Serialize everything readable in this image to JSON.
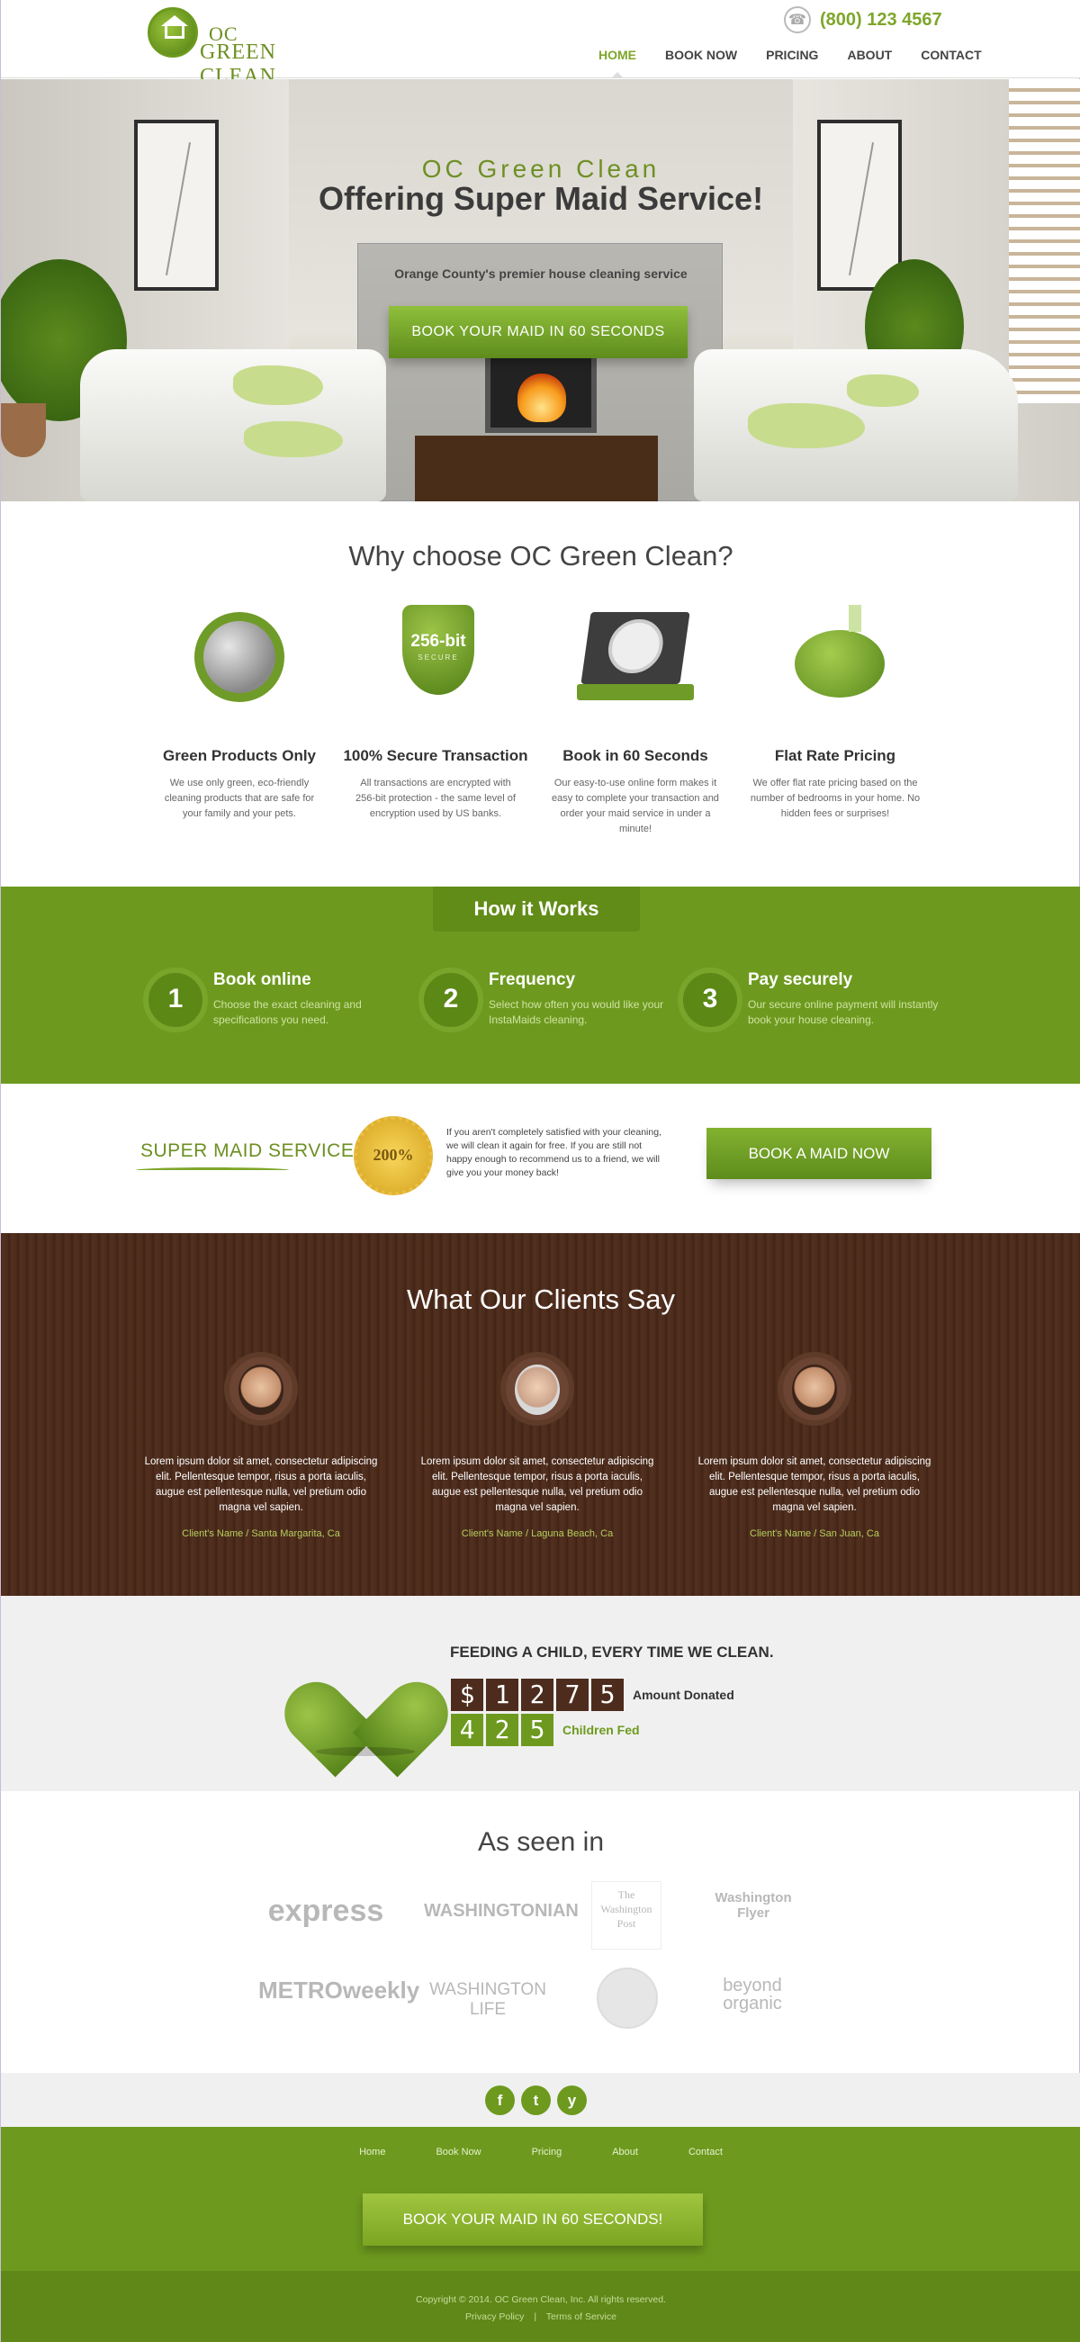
{
  "header": {
    "logo_line1": "OC",
    "logo_line2": "GREEN CLEAN",
    "phone": "(800) 123 4567",
    "nav": [
      "HOME",
      "BOOK NOW",
      "PRICING",
      "ABOUT",
      "CONTACT"
    ],
    "active_nav": "HOME"
  },
  "hero": {
    "brand": "OC Green Clean",
    "title": "Offering Super Maid Service!",
    "tagline": "Orange County's premier house cleaning service",
    "cta": "BOOK YOUR MAID IN 60 SECONDS"
  },
  "why": {
    "title": "Why choose OC Green Clean?",
    "features": [
      {
        "icon": "recycle-globe-icon",
        "title": "Green Products Only",
        "text": "We use only green, eco-friendly cleaning products that are safe for your family and your pets."
      },
      {
        "icon": "shield-256-bit-icon",
        "title": "100% Secure Transaction",
        "text": "All  transactions are encrypted with 256-bit protection - the same level of encryption used by US banks.",
        "badge_big": "256-bit",
        "badge_small": "SECURE"
      },
      {
        "icon": "laptop-clock-icon",
        "title": "Book in 60 Seconds",
        "text": "Our easy-to-use online form makes it easy to complete your transaction and order your maid service in under a minute!"
      },
      {
        "icon": "piggy-bank-icon",
        "title": "Flat Rate Pricing",
        "text": "We offer flat rate pricing based on the number of bedrooms in your home. No hidden fees or surprises!"
      }
    ]
  },
  "how": {
    "title": "How it Works",
    "steps": [
      {
        "num": "1",
        "title": "Book online",
        "text": "Choose the exact cleaning and specifications you need."
      },
      {
        "num": "2",
        "title": "Frequency",
        "text": "Select how often you would like your InstaMaids cleaning."
      },
      {
        "num": "3",
        "title": "Pay securely",
        "text": "Our secure online payment will instantly book your house cleaning."
      }
    ]
  },
  "guarantee": {
    "label": "SUPER MAID SERVICE",
    "seal": "200%",
    "text": "If you aren't completely satisfied with your cleaning, we will clean it again for free. If you are still not happy enough to recommend us to a friend, we will give you your money back!",
    "cta": "BOOK A MAID NOW"
  },
  "clients": {
    "title": "What Our Clients Say",
    "items": [
      {
        "text": "Lorem ipsum dolor sit amet, consectetur adipiscing elit. Pellentesque tempor, risus a porta iaculis, augue est pellentesque nulla, vel pretium odio magna vel sapien.",
        "who": "Client's Name / Santa Margarita, Ca"
      },
      {
        "text": "Lorem ipsum dolor sit amet, consectetur adipiscing elit. Pellentesque tempor, risus a porta iaculis, augue est pellentesque nulla, vel pretium odio magna vel sapien.",
        "who": "Client's Name / Laguna Beach, Ca"
      },
      {
        "text": "Lorem ipsum dolor sit amet, consectetur adipiscing elit. Pellentesque tempor, risus a porta iaculis, augue est pellentesque nulla, vel pretium odio magna vel sapien.",
        "who": "Client's Name / San Juan, Ca"
      }
    ]
  },
  "donate": {
    "title": "FEEDING A CHILD, EVERY TIME WE CLEAN.",
    "amount_digits": [
      "$",
      "1",
      "2",
      "7",
      "5"
    ],
    "amount_label": "Amount Donated",
    "children_digits": [
      "4",
      "2",
      "5"
    ],
    "children_label": "Children Fed"
  },
  "seen": {
    "title": "As seen in",
    "logos": [
      "express",
      "WASHINGTONIAN",
      "The Washington Post",
      "Washington Flyer",
      "METROweekly",
      "WASHINGTON LIFE",
      "seal",
      "beyond organic"
    ]
  },
  "social": [
    "f",
    "t",
    "y"
  ],
  "footer": {
    "nav": [
      "Home",
      "Book Now",
      "Pricing",
      "About",
      "Contact"
    ],
    "cta": "BOOK YOUR MAID IN 60 SECONDS!",
    "copyright": "Copyright ©  2014. OC Green Clean, Inc. All rights reserved.",
    "privacy": "Privacy Policy",
    "separator": "|",
    "terms": "Terms of Service"
  },
  "colors": {
    "brand_green": "#6d9a1e",
    "accent_green": "#7ea62a",
    "wood_brown": "#4a2a1c",
    "footer_green": "#5f8818"
  }
}
